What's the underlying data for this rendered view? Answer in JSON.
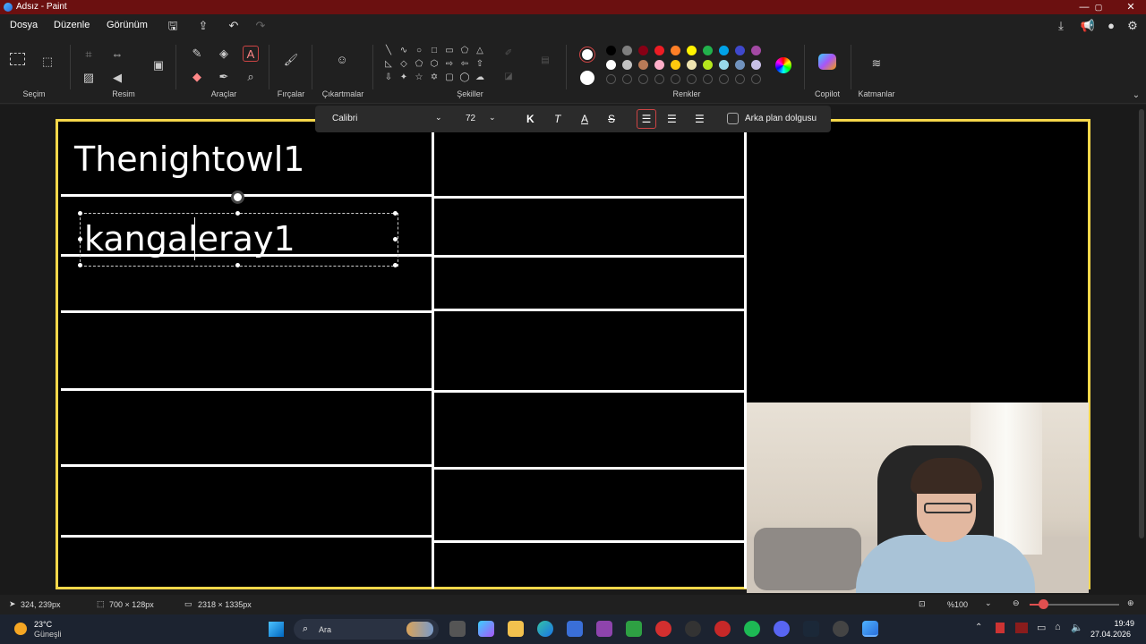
{
  "window": {
    "title": "Adsız - Paint",
    "min": "—",
    "max": "▢",
    "close": "✕"
  },
  "menu": {
    "items": [
      "Dosya",
      "Düzenle",
      "Görünüm"
    ]
  },
  "ribbon": {
    "groups": {
      "selection": "Seçim",
      "image": "Resim",
      "tools": "Araçlar",
      "brushes": "Fırçalar",
      "stickers": "Çıkartmalar",
      "shapes": "Şekiller",
      "colors": "Renkler",
      "copilot": "Copilot",
      "layers": "Katmanlar"
    },
    "palette_row1": [
      "#000000",
      "#7f7f7f",
      "#880015",
      "#ed1c24",
      "#ff7f27",
      "#fff200",
      "#22b14c",
      "#00a2e8",
      "#3f48cc",
      "#a349a4"
    ],
    "palette_row2": [
      "#ffffff",
      "#c3c3c3",
      "#b97a57",
      "#ffaec9",
      "#ffc90e",
      "#efe4b0",
      "#b5e61d",
      "#99d9ea",
      "#7092be",
      "#c8bfe7"
    ],
    "primary_color": "#ffffff",
    "secondary_color": "#ffffff"
  },
  "text_toolbar": {
    "font": "Calibri",
    "size": "72",
    "bold": "K",
    "italic": "T",
    "underline": "A",
    "strike": "S",
    "background_fill_label": "Arka plan dolgusu"
  },
  "canvas": {
    "text_title": "Thenightowl1",
    "text_editing": "kangaleray1"
  },
  "status": {
    "cursor_pos": "324, 239px",
    "selection_size": "700 × 128px",
    "canvas_size": "2318 × 1335px",
    "zoom": "%100"
  },
  "taskbar": {
    "weather_temp": "23°C",
    "weather_desc": "Güneşli",
    "search_label": "Ara",
    "time": "19:49",
    "date": "27.04.2026"
  }
}
